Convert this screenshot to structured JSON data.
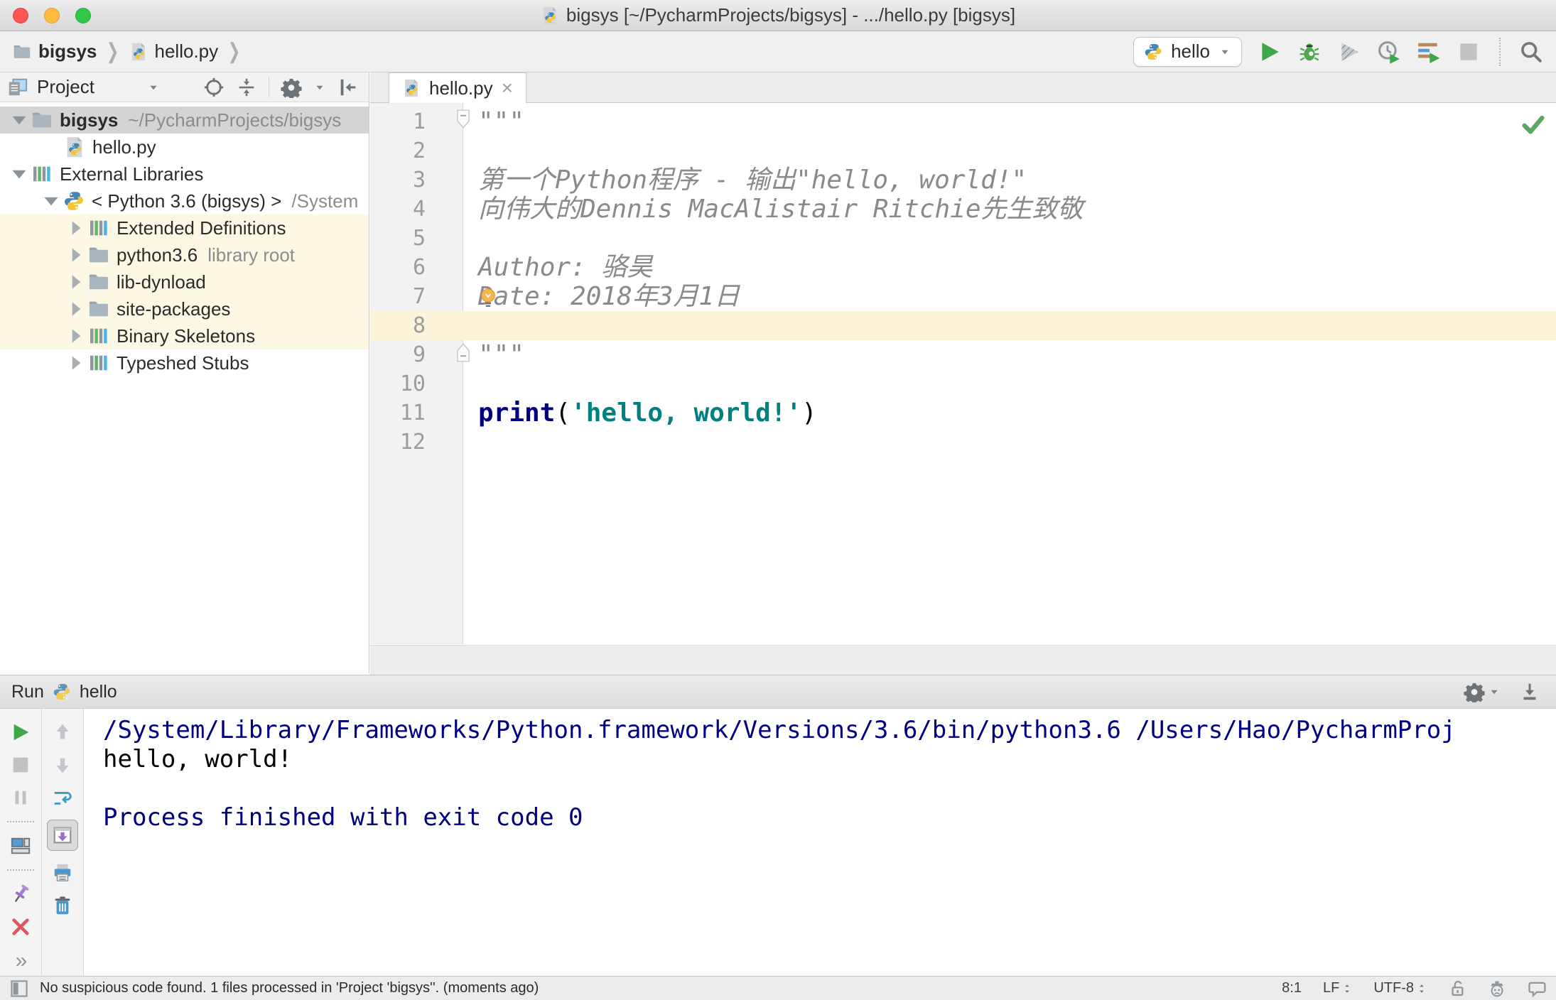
{
  "window": {
    "title": "bigsys [~/PycharmProjects/bigsys] - .../hello.py [bigsys]"
  },
  "nav": {
    "breadcrumbs": [
      "bigsys",
      "hello.py"
    ],
    "run_config": "hello"
  },
  "project_panel": {
    "title": "Project",
    "tree": [
      {
        "label": "bigsys",
        "hint": "~/PycharmProjects/bigsys",
        "icon": "folder",
        "chevron": "down",
        "indent": 0,
        "selected": true,
        "bold": true
      },
      {
        "label": "hello.py",
        "icon": "python-file",
        "indent": 2,
        "is_file": true
      },
      {
        "label": "External Libraries",
        "icon": "library",
        "chevron": "down",
        "indent": 0
      },
      {
        "label": "< Python 3.6 (bigsys) >",
        "hint": "/System",
        "icon": "python",
        "chevron": "down",
        "indent": 1
      },
      {
        "label": "Extended Definitions",
        "icon": "library",
        "chevron": "right",
        "indent": 2,
        "highlight": true
      },
      {
        "label": "python3.6",
        "hint": "library root",
        "icon": "folder",
        "chevron": "right",
        "indent": 2,
        "highlight": true
      },
      {
        "label": "lib-dynload",
        "icon": "folder",
        "chevron": "right",
        "indent": 2,
        "highlight": true
      },
      {
        "label": "site-packages",
        "icon": "folder",
        "chevron": "right",
        "indent": 2,
        "highlight": true
      },
      {
        "label": "Binary Skeletons",
        "icon": "library",
        "chevron": "right",
        "indent": 2,
        "highlight": true
      },
      {
        "label": "Typeshed Stubs",
        "icon": "library",
        "chevron": "right",
        "indent": 2
      }
    ]
  },
  "editor": {
    "tab": "hello.py",
    "caret_line": 8,
    "lines": [
      {
        "num": 1,
        "tokens": [
          {
            "text": "\"\"\"",
            "type": "doc"
          }
        ],
        "fold": "start"
      },
      {
        "num": 2,
        "tokens": []
      },
      {
        "num": 3,
        "tokens": [
          {
            "text": "第一个Python程序 - 输出\"hello, world!\"",
            "type": "doc"
          }
        ]
      },
      {
        "num": 4,
        "tokens": [
          {
            "text": "向伟大的Dennis MacAlistair Ritchie先生致敬",
            "type": "doc"
          }
        ]
      },
      {
        "num": 5,
        "tokens": []
      },
      {
        "num": 6,
        "tokens": [
          {
            "text": "Author: 骆昊",
            "type": "doc"
          }
        ]
      },
      {
        "num": 7,
        "tokens": [
          {
            "text": "Date: 2018年3月1日",
            "type": "doc"
          }
        ],
        "lightbulb": true
      },
      {
        "num": 8,
        "tokens": [],
        "caret": true
      },
      {
        "num": 9,
        "tokens": [
          {
            "text": "\"\"\"",
            "type": "doc"
          }
        ],
        "fold": "end"
      },
      {
        "num": 10,
        "tokens": []
      },
      {
        "num": 11,
        "tokens": [
          {
            "text": "print",
            "type": "keyword"
          },
          {
            "text": "(",
            "type": "plain"
          },
          {
            "text": "'hello, world!'",
            "type": "string"
          },
          {
            "text": ")",
            "type": "plain"
          }
        ]
      },
      {
        "num": 12,
        "tokens": []
      }
    ]
  },
  "run_panel": {
    "title": "Run",
    "config_name": "hello",
    "console": [
      {
        "text": "/System/Library/Frameworks/Python.framework/Versions/3.6/bin/python3.6 /Users/Hao/PycharmProj",
        "style": "system"
      },
      {
        "text": "hello, world!",
        "style": "stdout"
      },
      {
        "text": "",
        "style": "stdout"
      },
      {
        "text": "Process finished with exit code 0",
        "style": "system"
      }
    ]
  },
  "status_bar": {
    "message": "No suspicious code found. 1 files processed in 'Project 'bigsys''. (moments ago)",
    "caret_position": "8:1",
    "line_ending": "LF",
    "encoding": "UTF-8"
  },
  "colors": {
    "run_green": "#3da84a",
    "selection_gray": "#d4d4d4",
    "library_highlight_yellow": "#fcf8e3",
    "caret_line_yellow": "#fcf3d9",
    "keyword_blue": "#000080",
    "string_teal": "#008080",
    "comment_gray": "#8a8a8a",
    "console_system_blue": "#000080",
    "close_red": "#db5860"
  }
}
